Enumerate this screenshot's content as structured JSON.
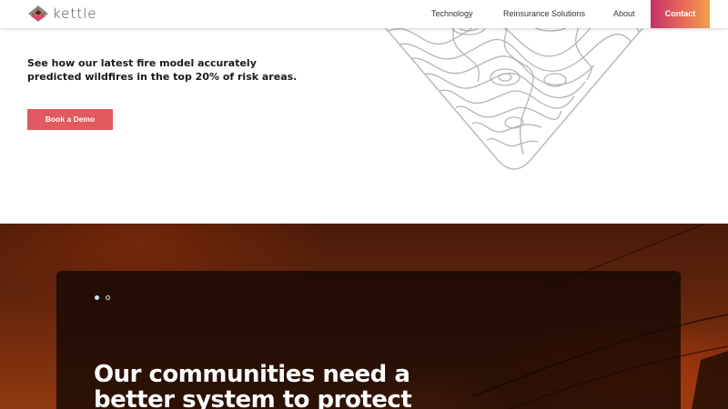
{
  "brand": {
    "name": "kettle",
    "colors": {
      "accent_red": "#e05a5f",
      "contact_gradient": [
        "#c4316a",
        "#e96a58",
        "#f0a04a"
      ],
      "dot_blue": "#cde6ff"
    },
    "logo_icon": "kettle-layered-diamond-logo"
  },
  "nav": {
    "items": [
      {
        "label": "Technology"
      },
      {
        "label": "Reinsurance Solutions"
      },
      {
        "label": "About"
      }
    ],
    "contact_label": "Contact"
  },
  "hero": {
    "description": "See how our latest fire model accurately predicted wildfires in the top 20% of risk areas.",
    "cta_label": "Book a Demo",
    "illustration_icon": "topographic-map-diamond"
  },
  "slider": {
    "dots": [
      {
        "active": true
      },
      {
        "active": false
      }
    ],
    "heading": "Our communities need a better system to protect"
  }
}
